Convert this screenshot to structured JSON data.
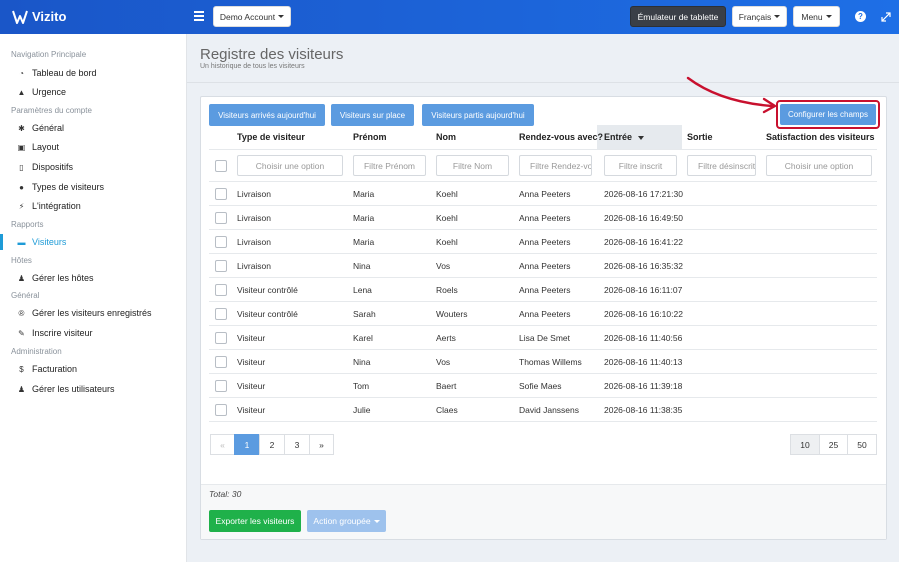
{
  "app": {
    "name": "Vizito"
  },
  "topbar": {
    "account": "Demo Account",
    "tablet": "Émulateur de tablette",
    "language": "Français",
    "menu": "Menu"
  },
  "sidebar": {
    "sections": [
      {
        "title": "Navigation Principale",
        "items": [
          {
            "label": "Tableau de bord",
            "icon": "dashboard-icon"
          },
          {
            "label": "Urgence",
            "icon": "warning-icon"
          }
        ]
      },
      {
        "title": "Paramètres du compte",
        "items": [
          {
            "label": "Général",
            "icon": "gear-icon"
          },
          {
            "label": "Layout",
            "icon": "image-icon"
          },
          {
            "label": "Dispositifs",
            "icon": "tablet-icon"
          },
          {
            "label": "Types de visiteurs",
            "icon": "users-icon"
          },
          {
            "label": "L'intégration",
            "icon": "plug-icon"
          }
        ]
      },
      {
        "title": "Rapports",
        "items": [
          {
            "label": "Visiteurs",
            "icon": "book-icon",
            "active": true
          }
        ]
      },
      {
        "title": "Hôtes",
        "items": [
          {
            "label": "Gérer les hôtes",
            "icon": "person-icon"
          }
        ]
      },
      {
        "title": "Général",
        "items": [
          {
            "label": "Gérer les visiteurs enregistrés",
            "icon": "registered-icon"
          },
          {
            "label": "Inscrire visiteur",
            "icon": "pencil-icon"
          }
        ]
      },
      {
        "title": "Administration",
        "items": [
          {
            "label": "Facturation",
            "icon": "dollar-icon"
          },
          {
            "label": "Gérer les utilisateurs",
            "icon": "user-plus-icon"
          }
        ]
      }
    ]
  },
  "main": {
    "title": "Registre des visiteurs",
    "subtitle": "Un historique de tous les visiteurs",
    "buttons": {
      "arrived": "Visiteurs arrivés aujourd'hui",
      "onsite": "Visiteurs sur place",
      "left": "Visiteurs partis aujourd'hui",
      "configure": "Configurer les champs"
    },
    "columns": [
      "Type de visiteur",
      "Prénom",
      "Nom",
      "Rendez-vous avec?",
      "Entrée",
      "Sortie",
      "Satisfaction des visiteurs"
    ],
    "filters": {
      "type": "Choisir une option",
      "firstname": "Filtre Prénom",
      "lastname": "Filtre Nom",
      "appointment": "Filtre Rendez-vous avec",
      "entry": "Filtre inscrit",
      "exit": "Filtre désinscrit",
      "satisfaction": "Choisir une option"
    },
    "rows": [
      {
        "type": "Livraison",
        "first": "Maria",
        "last": "Koehl",
        "with": "Anna Peeters",
        "entry": "2026-08-16 17:21:30"
      },
      {
        "type": "Livraison",
        "first": "Maria",
        "last": "Koehl",
        "with": "Anna Peeters",
        "entry": "2026-08-16 16:49:50"
      },
      {
        "type": "Livraison",
        "first": "Maria",
        "last": "Koehl",
        "with": "Anna Peeters",
        "entry": "2026-08-16 16:41:22"
      },
      {
        "type": "Livraison",
        "first": "Nina",
        "last": "Vos",
        "with": "Anna Peeters",
        "entry": "2026-08-16 16:35:32"
      },
      {
        "type": "Visiteur contrôlé",
        "first": "Lena",
        "last": "Roels",
        "with": "Anna Peeters",
        "entry": "2026-08-16 16:11:07"
      },
      {
        "type": "Visiteur contrôlé",
        "first": "Sarah",
        "last": "Wouters",
        "with": "Anna Peeters",
        "entry": "2026-08-16 16:10:22"
      },
      {
        "type": "Visiteur",
        "first": "Karel",
        "last": "Aerts",
        "with": "Lisa De Smet",
        "entry": "2026-08-16 11:40:56"
      },
      {
        "type": "Visiteur",
        "first": "Nina",
        "last": "Vos",
        "with": "Thomas Willems",
        "entry": "2026-08-16 11:40:13"
      },
      {
        "type": "Visiteur",
        "first": "Tom",
        "last": "Baert",
        "with": "Sofie Maes",
        "entry": "2026-08-16 11:39:18"
      },
      {
        "type": "Visiteur",
        "first": "Julie",
        "last": "Claes",
        "with": "David Janssens",
        "entry": "2026-08-16 11:38:35"
      }
    ],
    "pagination": {
      "prev": "«",
      "pages": [
        "1",
        "2",
        "3"
      ],
      "next": "»",
      "current": "1"
    },
    "page_sizes": [
      "10",
      "25",
      "50"
    ],
    "page_size_current": "10",
    "total": "Total: 30",
    "export": "Exporter les visiteurs",
    "bulk_action": "Action groupée"
  },
  "colors": {
    "brand": "#1e6fe6",
    "button": "#5b9be0",
    "success": "#1fb14a",
    "highlight": "#c8102e",
    "active_nav": "#1e9bd7"
  }
}
